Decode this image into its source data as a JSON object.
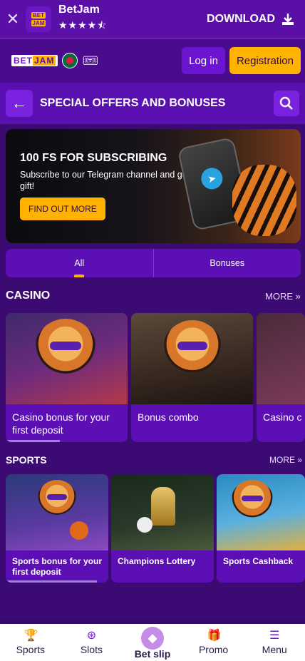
{
  "app_banner": {
    "name": "BetJam",
    "logo_top": "BET",
    "logo_bottom": "JAM",
    "rating_stars": "★★★★⯪",
    "download_label": "DOWNLOAD"
  },
  "header": {
    "logo_text_a": "BET",
    "logo_text_b": "JAM",
    "login_label": "Log in",
    "registration_label": "Registration"
  },
  "title_bar": {
    "title": "SPECIAL OFFERS AND BONUSES"
  },
  "hero": {
    "title": "100 FS FOR SUBSCRIBING",
    "text": "Subscribe to our Telegram channel and get a gift!",
    "cta": "FIND OUT MORE"
  },
  "tabs": [
    {
      "label": "All",
      "active": true
    },
    {
      "label": "Bonuses",
      "active": false
    }
  ],
  "casino": {
    "title": "CASINO",
    "more": "MORE »",
    "cards": [
      {
        "label": "Casino bonus for your first deposit"
      },
      {
        "label": "Bonus combo"
      },
      {
        "label": "Casino c"
      }
    ]
  },
  "sports": {
    "title": "SPORTS",
    "more": "MORE »",
    "cards": [
      {
        "label": "Sports bonus for your first deposit"
      },
      {
        "label": "Champions Lottery"
      },
      {
        "label": "Sports Cashback"
      }
    ]
  },
  "bottom_nav": [
    {
      "label": "Sports",
      "icon": "trophy-icon"
    },
    {
      "label": "Slots",
      "icon": "chip-icon"
    },
    {
      "label": "Bet slip",
      "icon": "ticket-icon"
    },
    {
      "label": "Promo",
      "icon": "gift-icon"
    },
    {
      "label": "Menu",
      "icon": "menu-icon"
    }
  ],
  "colors": {
    "brand_purple": "#5a0fa6",
    "accent_yellow": "#ffb300",
    "background": "#3b0a73"
  }
}
